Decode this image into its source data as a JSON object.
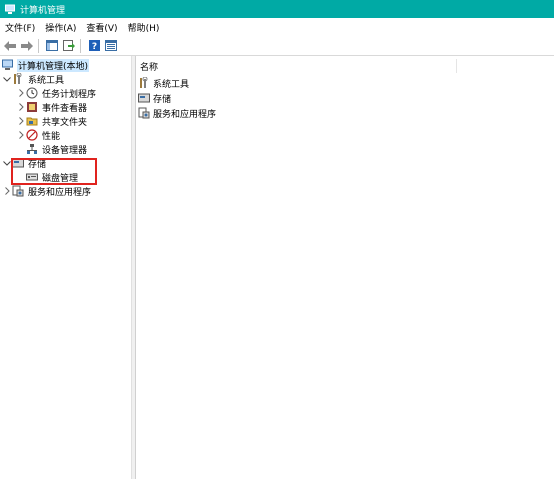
{
  "window": {
    "title": "计算机管理"
  },
  "menu": [
    "文件(F)",
    "操作(A)",
    "查看(V)",
    "帮助(H)"
  ],
  "toolbar": {
    "back_icon": "back-arrow-icon",
    "forward_icon": "forward-arrow-icon",
    "show_hide_tree_icon": "console-tree-icon",
    "export_icon": "export-list-icon",
    "help_icon": "help-icon",
    "properties_icon": "properties-icon"
  },
  "tree": {
    "root": "计算机管理(本地)",
    "system_tools": "系统工具",
    "task_scheduler": "任务计划程序",
    "event_viewer": "事件查看器",
    "shared_folders": "共享文件夹",
    "performance": "性能",
    "device_manager": "设备管理器",
    "storage": "存储",
    "disk_management": "磁盘管理",
    "services_apps": "服务和应用程序"
  },
  "list": {
    "header_name": "名称",
    "items": [
      "系统工具",
      "存储",
      "服务和应用程序"
    ]
  },
  "colors": {
    "titlebar": "#00aaa5",
    "highlight": "#e0231e",
    "selection": "#cce8ff"
  }
}
